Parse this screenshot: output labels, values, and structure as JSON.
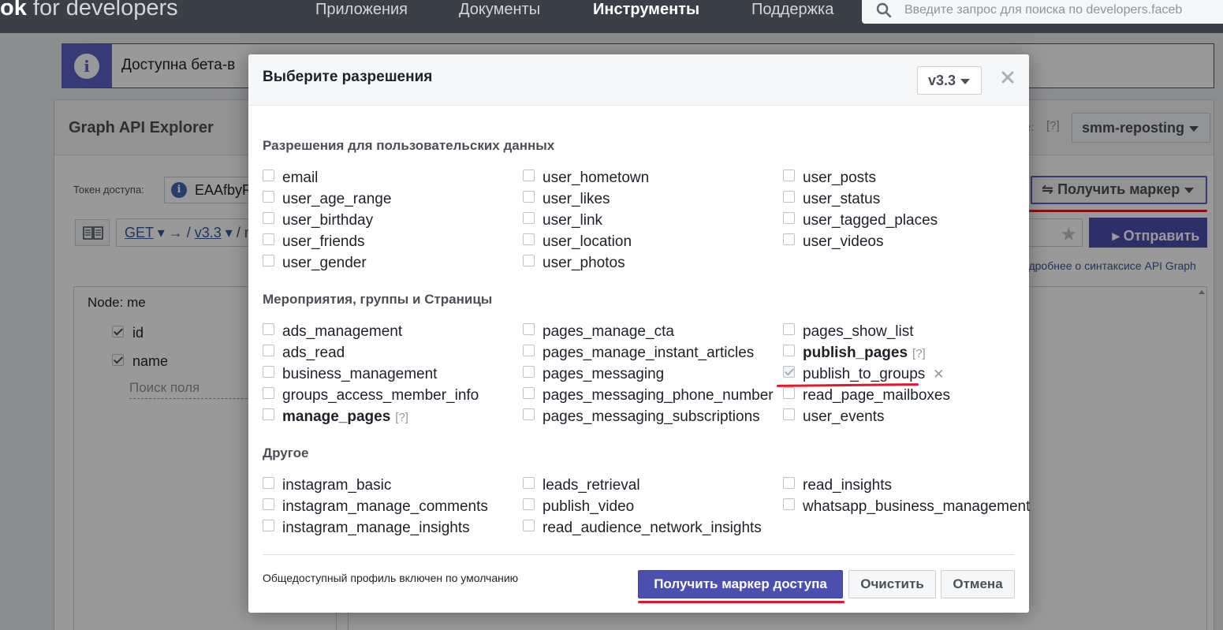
{
  "topbar": {
    "brand_bold": "ok",
    "brand_rest": " for developers",
    "nav": [
      "Приложения",
      "Документы",
      "Инструменты",
      "Поддержка"
    ],
    "active_nav": "Инструменты",
    "search_placeholder": "Введите запрос для поиска по developers.faceb"
  },
  "banner": {
    "icon": "i",
    "text": "Доступна бета-в"
  },
  "explorer": {
    "title": "Graph API Explorer",
    "app_label": "e:",
    "app_help": "[?]",
    "app_name": "smm-reposting",
    "token_label": "Токен доступа:",
    "token_value": "EAAfbyR",
    "get_token_button": "Получить маркер",
    "method": "GET",
    "version": "v3.3",
    "path_rest": "/ m",
    "submit_button": "Отправить",
    "syntax_link": "одробнее о синтаксисе API Graph",
    "node_title": "Node:  me",
    "fields": [
      {
        "name": "id",
        "checked": true
      },
      {
        "name": "name",
        "checked": true
      }
    ],
    "field_search": "Поиск поля"
  },
  "modal": {
    "title": "Выберите разрешения",
    "version": "v3.3",
    "sections": [
      {
        "title": "Разрешения для пользовательских данных",
        "columns": [
          [
            {
              "name": "email"
            },
            {
              "name": "user_age_range"
            },
            {
              "name": "user_birthday"
            },
            {
              "name": "user_friends"
            },
            {
              "name": "user_gender"
            }
          ],
          [
            {
              "name": "user_hometown"
            },
            {
              "name": "user_likes"
            },
            {
              "name": "user_link"
            },
            {
              "name": "user_location"
            },
            {
              "name": "user_photos"
            }
          ],
          [
            {
              "name": "user_posts"
            },
            {
              "name": "user_status"
            },
            {
              "name": "user_tagged_places"
            },
            {
              "name": "user_videos"
            }
          ]
        ]
      },
      {
        "title": "Мероприятия, группы и Страницы",
        "columns": [
          [
            {
              "name": "ads_management"
            },
            {
              "name": "ads_read"
            },
            {
              "name": "business_management"
            },
            {
              "name": "groups_access_member_info"
            },
            {
              "name": "manage_pages",
              "bold": true,
              "help": "[?]"
            }
          ],
          [
            {
              "name": "pages_manage_cta"
            },
            {
              "name": "pages_manage_instant_articles"
            },
            {
              "name": "pages_messaging"
            },
            {
              "name": "pages_messaging_phone_number"
            },
            {
              "name": "pages_messaging_subscriptions"
            }
          ],
          [
            {
              "name": "pages_show_list"
            },
            {
              "name": "publish_pages",
              "bold": true,
              "help": "[?]"
            },
            {
              "name": "publish_to_groups",
              "checked": true,
              "disabled": true,
              "remove": "✕"
            },
            {
              "name": "read_page_mailboxes"
            },
            {
              "name": "user_events"
            }
          ]
        ]
      },
      {
        "title": "Другое",
        "columns": [
          [
            {
              "name": "instagram_basic"
            },
            {
              "name": "instagram_manage_comments"
            },
            {
              "name": "instagram_manage_insights"
            }
          ],
          [
            {
              "name": "leads_retrieval"
            },
            {
              "name": "publish_video"
            },
            {
              "name": "read_audience_network_insights"
            }
          ],
          [
            {
              "name": "read_insights"
            },
            {
              "name": "whatsapp_business_management"
            }
          ]
        ]
      }
    ],
    "footer_note": "Общедоступный профиль включен по умолчанию",
    "get_access_token_button": "Получить маркер доступа",
    "clear_button": "Очистить",
    "cancel_button": "Отмена"
  },
  "colors": {
    "topbar": "#3b4048",
    "accent": "#4b4fb0",
    "annotation_underline": "#e3162c"
  }
}
